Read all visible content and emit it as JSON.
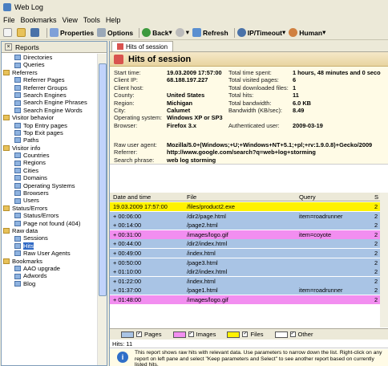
{
  "window": {
    "title": "Web Log"
  },
  "menu": [
    "File",
    "Bookmarks",
    "View",
    "Tools",
    "Help"
  ],
  "toolbar": {
    "properties": "Properties",
    "options": "Options",
    "back": "Back",
    "refresh": "Refresh",
    "ip_timeout": "IP/Timeout",
    "human": "Human"
  },
  "left_panel": {
    "title": "Reports",
    "items": [
      {
        "label": "Directories",
        "type": "leaf"
      },
      {
        "label": "Queries",
        "type": "leaf"
      },
      {
        "label": "Referrers",
        "type": "cat"
      },
      {
        "label": "Referrer Pages",
        "type": "leaf"
      },
      {
        "label": "Referrer Groups",
        "type": "leaf"
      },
      {
        "label": "Search Engines",
        "type": "leaf"
      },
      {
        "label": "Search Engine Phrases",
        "type": "leaf"
      },
      {
        "label": "Search Engine Words",
        "type": "leaf"
      },
      {
        "label": "Visitor behavior",
        "type": "cat"
      },
      {
        "label": "Top Entry pages",
        "type": "leaf"
      },
      {
        "label": "Top Exit pages",
        "type": "leaf"
      },
      {
        "label": "Paths",
        "type": "leaf"
      },
      {
        "label": "Visitor info",
        "type": "cat"
      },
      {
        "label": "Countries",
        "type": "leaf"
      },
      {
        "label": "Regions",
        "type": "leaf"
      },
      {
        "label": "Cities",
        "type": "leaf"
      },
      {
        "label": "Domains",
        "type": "leaf"
      },
      {
        "label": "Operating Systems",
        "type": "leaf"
      },
      {
        "label": "Browsers",
        "type": "leaf"
      },
      {
        "label": "Users",
        "type": "leaf"
      },
      {
        "label": "Status/Errors",
        "type": "cat"
      },
      {
        "label": "Status/Errors",
        "type": "leaf"
      },
      {
        "label": "Page not found (404)",
        "type": "leaf"
      },
      {
        "label": "Raw data",
        "type": "cat"
      },
      {
        "label": "Sessions",
        "type": "leaf"
      },
      {
        "label": "Hits",
        "type": "leaf",
        "selected": true
      },
      {
        "label": "Raw User Agents",
        "type": "leaf"
      },
      {
        "label": "Bookmarks",
        "type": "cat"
      },
      {
        "label": "AAO upgrade",
        "type": "leaf"
      },
      {
        "label": "Adwords",
        "type": "leaf"
      },
      {
        "label": "Blog",
        "type": "leaf"
      }
    ]
  },
  "tab": {
    "label": "Hits of session"
  },
  "header": {
    "title": "Hits of session"
  },
  "info_left": [
    {
      "k": "Start time:",
      "v": "19.03.2009 17:57:00"
    },
    {
      "k": "Client IP:",
      "v": "68.188.197.227"
    },
    {
      "k": "Client host:",
      "v": ""
    },
    {
      "k": "County:",
      "v": "United States"
    },
    {
      "k": "Region:",
      "v": "Michigan"
    },
    {
      "k": "City:",
      "v": "Calumet"
    },
    {
      "k": "Operating system:",
      "v": "Windows XP or SP3"
    },
    {
      "k": "Browser:",
      "v": "Firefox 3.x"
    }
  ],
  "info_right": [
    {
      "k": "Total time spent:",
      "v": "1 hours, 48 minutes and 0 seco"
    },
    {
      "k": "Total visited pages:",
      "v": "6"
    },
    {
      "k": "Total downloaded files:",
      "v": "1"
    },
    {
      "k": "Total hits:",
      "v": "11"
    },
    {
      "k": "Total bandwidth:",
      "v": "6.0 KB"
    },
    {
      "k": "Bandwidth (KB/sec):",
      "v": "8.49"
    },
    {
      "k": "",
      "v": ""
    },
    {
      "k": "Authenticated user:",
      "v": "2009-03-19"
    }
  ],
  "info_bottom": [
    {
      "k": "Raw user agent:",
      "v": "Mozilla/5.0+(Windows;+U;+Windows+NT+5.1;+pl;+rv:1.9.0.8)+Gecko/2009"
    },
    {
      "k": "Referrer:",
      "v": "http://www.google.com/search?q=web+log+storming"
    },
    {
      "k": "Search phrase:",
      "v": "web log storming"
    }
  ],
  "table": {
    "headers": {
      "date": "Date and time",
      "file": "File",
      "query": "Query",
      "n": "S"
    },
    "rows": [
      {
        "date": "19.03.2009 17:57:00",
        "file": "/files/product2.exe",
        "query": "",
        "n": "2",
        "kind": "files"
      },
      {
        "date": "+ 00:06:00",
        "file": "/dir2/page.html",
        "query": "item=roadrunner",
        "n": "2",
        "kind": "pages"
      },
      {
        "date": "+ 00:14:00",
        "file": "/page2.html",
        "query": "",
        "n": "2",
        "kind": "pages"
      },
      {
        "date": "+ 00:31:00",
        "file": "/images/logo.gif",
        "query": "item=coyote",
        "n": "2",
        "kind": "images"
      },
      {
        "date": "+ 00:44:00",
        "file": "/dir2/index.html",
        "query": "",
        "n": "2",
        "kind": "pages"
      },
      {
        "date": "+ 00:49:00",
        "file": "/index.html",
        "query": "",
        "n": "2",
        "kind": "pages"
      },
      {
        "date": "+ 00:50:00",
        "file": "/page3.html",
        "query": "",
        "n": "2",
        "kind": "pages"
      },
      {
        "date": "+ 01:10:00",
        "file": "/dir2/index.html",
        "query": "",
        "n": "2",
        "kind": "pages"
      },
      {
        "date": "+ 01:22:00",
        "file": "/index.html",
        "query": "",
        "n": "2",
        "kind": "pages"
      },
      {
        "date": "+ 01:37:00",
        "file": "/page1.html",
        "query": "item=roadrunner",
        "n": "2",
        "kind": "pages"
      },
      {
        "date": "+ 01:48:00",
        "file": "/images/logo.gif",
        "query": "",
        "n": "2",
        "kind": "images"
      }
    ]
  },
  "legend": [
    {
      "label": "Pages",
      "color": "#a9c4e5"
    },
    {
      "label": "Images",
      "color": "#f28ef0"
    },
    {
      "label": "Files",
      "color": "#fff200"
    },
    {
      "label": "Other",
      "color": "#ffffff"
    }
  ],
  "hits_label": "Hits: 11",
  "note": "This report shows raw hits with relevant data. Use parameters to narrow down the list. Right-click on any report on left pane and select \"Keep parameters and Select\" to see another report based on currently listed hits."
}
